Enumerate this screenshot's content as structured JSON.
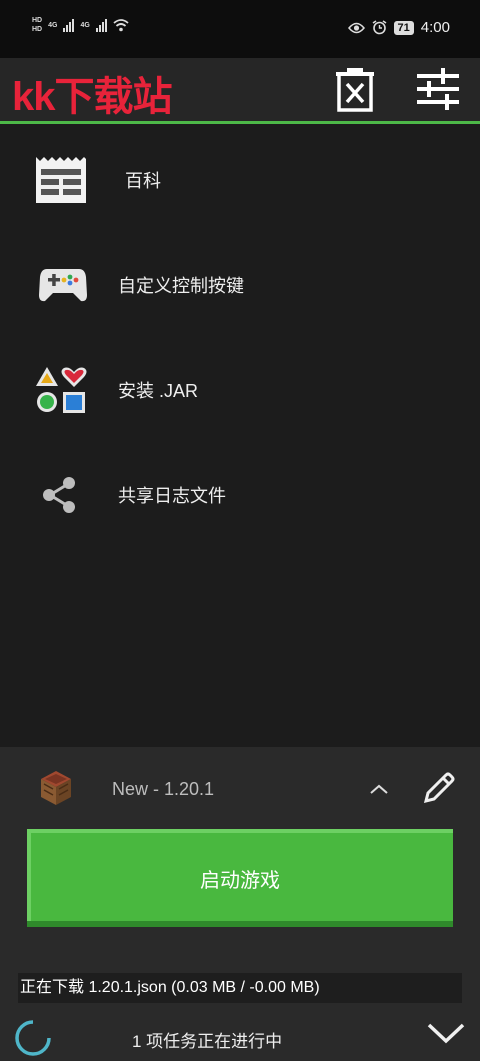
{
  "status_bar": {
    "hd1": "HD",
    "hd2": "HD",
    "net1": "4G",
    "net2": "4G",
    "battery": "71",
    "time": "4:00"
  },
  "app_bar": {
    "title": "kk下载站"
  },
  "menu": {
    "items": [
      {
        "label": "百科",
        "icon": "newspaper-icon"
      },
      {
        "label": "自定义控制按键",
        "icon": "gamepad-icon"
      },
      {
        "label": "安装 .JAR",
        "icon": "shapes-icon"
      },
      {
        "label": "共享日志文件",
        "icon": "share-icon"
      }
    ]
  },
  "profile": {
    "name": "New - 1.20.1"
  },
  "launch": {
    "label": "启动游戏"
  },
  "download": {
    "status": "正在下载 1.20.1.json (0.03 MB / -0.00 MB)"
  },
  "tasks": {
    "status": "1 项任务正在进行中"
  },
  "colors": {
    "accent": "#4db848",
    "title": "#e8233a",
    "launch_button": "#49b83f"
  }
}
